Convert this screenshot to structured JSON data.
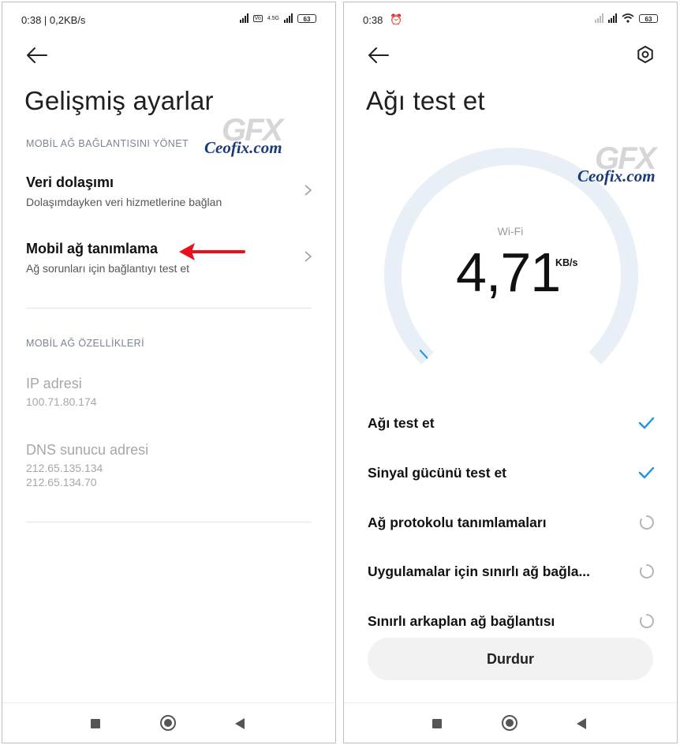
{
  "left": {
    "status": {
      "time": "0:38 | 0,2KB/s",
      "battery": "63",
      "network_badge": "4.5G"
    },
    "title": "Gelişmiş ayarlar",
    "section1": "MOBİL AĞ BAĞLANTISINI YÖNET",
    "items": [
      {
        "title": "Veri dolaşımı",
        "subtitle": "Dolaşımdayken veri hizmetlerine bağlan"
      },
      {
        "title": "Mobil ağ tanımlama",
        "subtitle": "Ağ sorunları için bağlantıyı test et"
      }
    ],
    "section2": "MOBİL AĞ ÖZELLİKLERİ",
    "ip": {
      "label": "IP adresi",
      "value": "100.71.80.174"
    },
    "dns": {
      "label": "DNS sunucu adresi",
      "value1": "212.65.135.134",
      "value2": "212.65.134.70"
    },
    "watermark": {
      "logo": "GFX",
      "site": "Ceofix.com"
    }
  },
  "right": {
    "status": {
      "time": "0:38",
      "battery": "63"
    },
    "title": "Ağı test et",
    "network_type": "Wi-Fi",
    "speed": "4,71",
    "unit": "KB/s",
    "gauge_progress": 0.02,
    "tests": [
      {
        "label": "Ağı test et",
        "state": "done"
      },
      {
        "label": "Sinyal gücünü test et",
        "state": "done"
      },
      {
        "label": "Ağ protokolu tanımlamaları",
        "state": "pending"
      },
      {
        "label": "Uygulamalar için sınırlı ağ bağla...",
        "state": "pending"
      },
      {
        "label": "Sınırlı arkaplan ağ bağlantısı",
        "state": "pending"
      }
    ],
    "stop_button": "Durdur",
    "watermark": {
      "logo": "GFX",
      "site": "Ceofix.com"
    }
  },
  "colors": {
    "accent": "#1e90e6",
    "arrow": "#e8101a",
    "gauge_track": "#e9eff7"
  }
}
